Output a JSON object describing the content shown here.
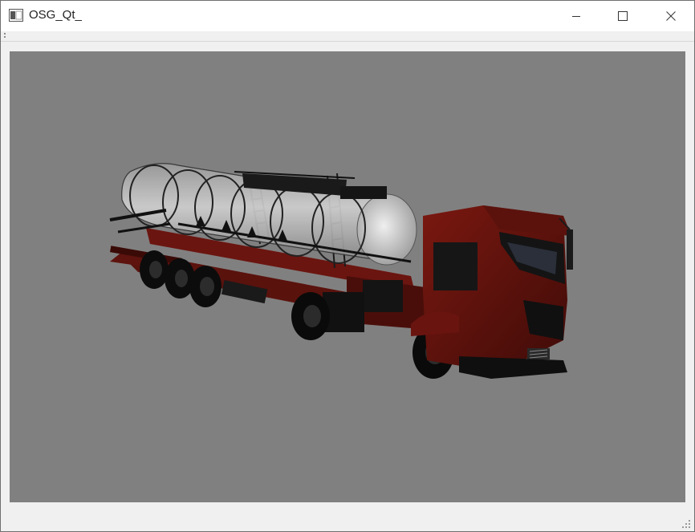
{
  "window": {
    "title": "OSG_Qt_",
    "icon": "app-window-icon",
    "controls": {
      "minimize_icon": "minimize-icon",
      "maximize_icon": "maximize-icon",
      "close_icon": "close-icon"
    }
  },
  "viewport": {
    "background_color": "#808080",
    "scene": {
      "model": "tanker-truck-3d-model",
      "body_color": "#6b1510"
    }
  }
}
